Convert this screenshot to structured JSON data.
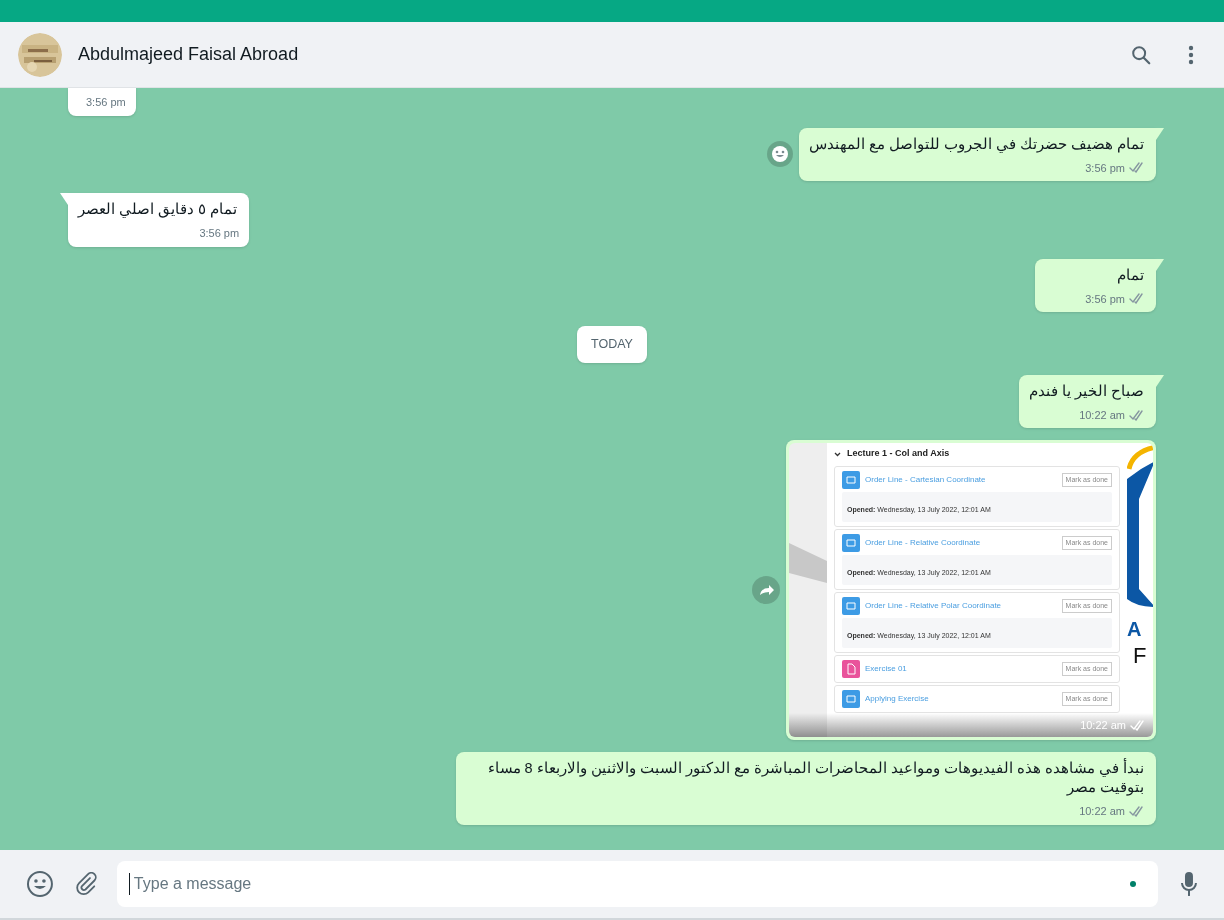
{
  "header": {
    "contact_name": "Abdulmajeed Faisal Abroad"
  },
  "messages": [
    {
      "kind": "incoming",
      "time": "3:56 pm",
      "tail": false,
      "ticks": false,
      "hover_action": false
    },
    {
      "kind": "outgoing",
      "text": "تمام هضيف حضرتك في الجروب للتواصل مع المهندس",
      "time": "3:56 pm",
      "tail": true,
      "ticks": true,
      "hover_action": true
    },
    {
      "kind": "incoming",
      "text": "تمام ٥ دقايق اصلي العصر",
      "time": "3:56 pm",
      "tail": true,
      "ticks": false,
      "hover_action": false
    },
    {
      "kind": "outgoing",
      "text": "تمام",
      "time": "3:56 pm",
      "tail": true,
      "ticks": true,
      "hover_action": false
    },
    {
      "kind": "date",
      "text": "TODAY"
    },
    {
      "kind": "outgoing",
      "text": "صباح الخير يا فندم",
      "time": "10:22 am",
      "tail": true,
      "ticks": true,
      "hover_action": false
    },
    {
      "kind": "outgoing_image",
      "time": "10:22 am",
      "tail": false,
      "ticks": true,
      "hover_action": true,
      "screenshot": {
        "title": "Lecture 1 - Col and Axis",
        "logo_letters": [
          "A",
          "F"
        ],
        "items": [
          {
            "kind": "page",
            "title": "Order Line - Cartesian Coordinate",
            "button": "Mark as done",
            "opened": "**Opened:** Wednesday, 13 July 2022, 12:01 AM"
          },
          {
            "kind": "page",
            "title": "Order Line - Relative Coordinate",
            "button": "Mark as done",
            "opened": "**Opened:** Wednesday, 13 July 2022, 12:01 AM"
          },
          {
            "kind": "page",
            "title": "Order Line - Relative Polar Coordinate",
            "button": "Mark as done",
            "opened": "**Opened:** Wednesday, 13 July 2022, 12:01 AM"
          },
          {
            "kind": "file",
            "title": "Exercise 01",
            "button": "Mark as done"
          },
          {
            "kind": "page",
            "title": "Applying Exercise",
            "button": "Mark as done"
          }
        ]
      }
    },
    {
      "kind": "outgoing",
      "text": "نبدأ في مشاهده هذه الفيديوهات ومواعيد المحاضرات المباشرة مع الدكتور السبت والاثنين والاربعاء 8 مساء بتوقيت مصر",
      "time": "10:22 am",
      "tail": false,
      "ticks": true,
      "hover_action": false
    }
  ],
  "composer": {
    "placeholder": "Type a message",
    "typing_indicator": true
  }
}
